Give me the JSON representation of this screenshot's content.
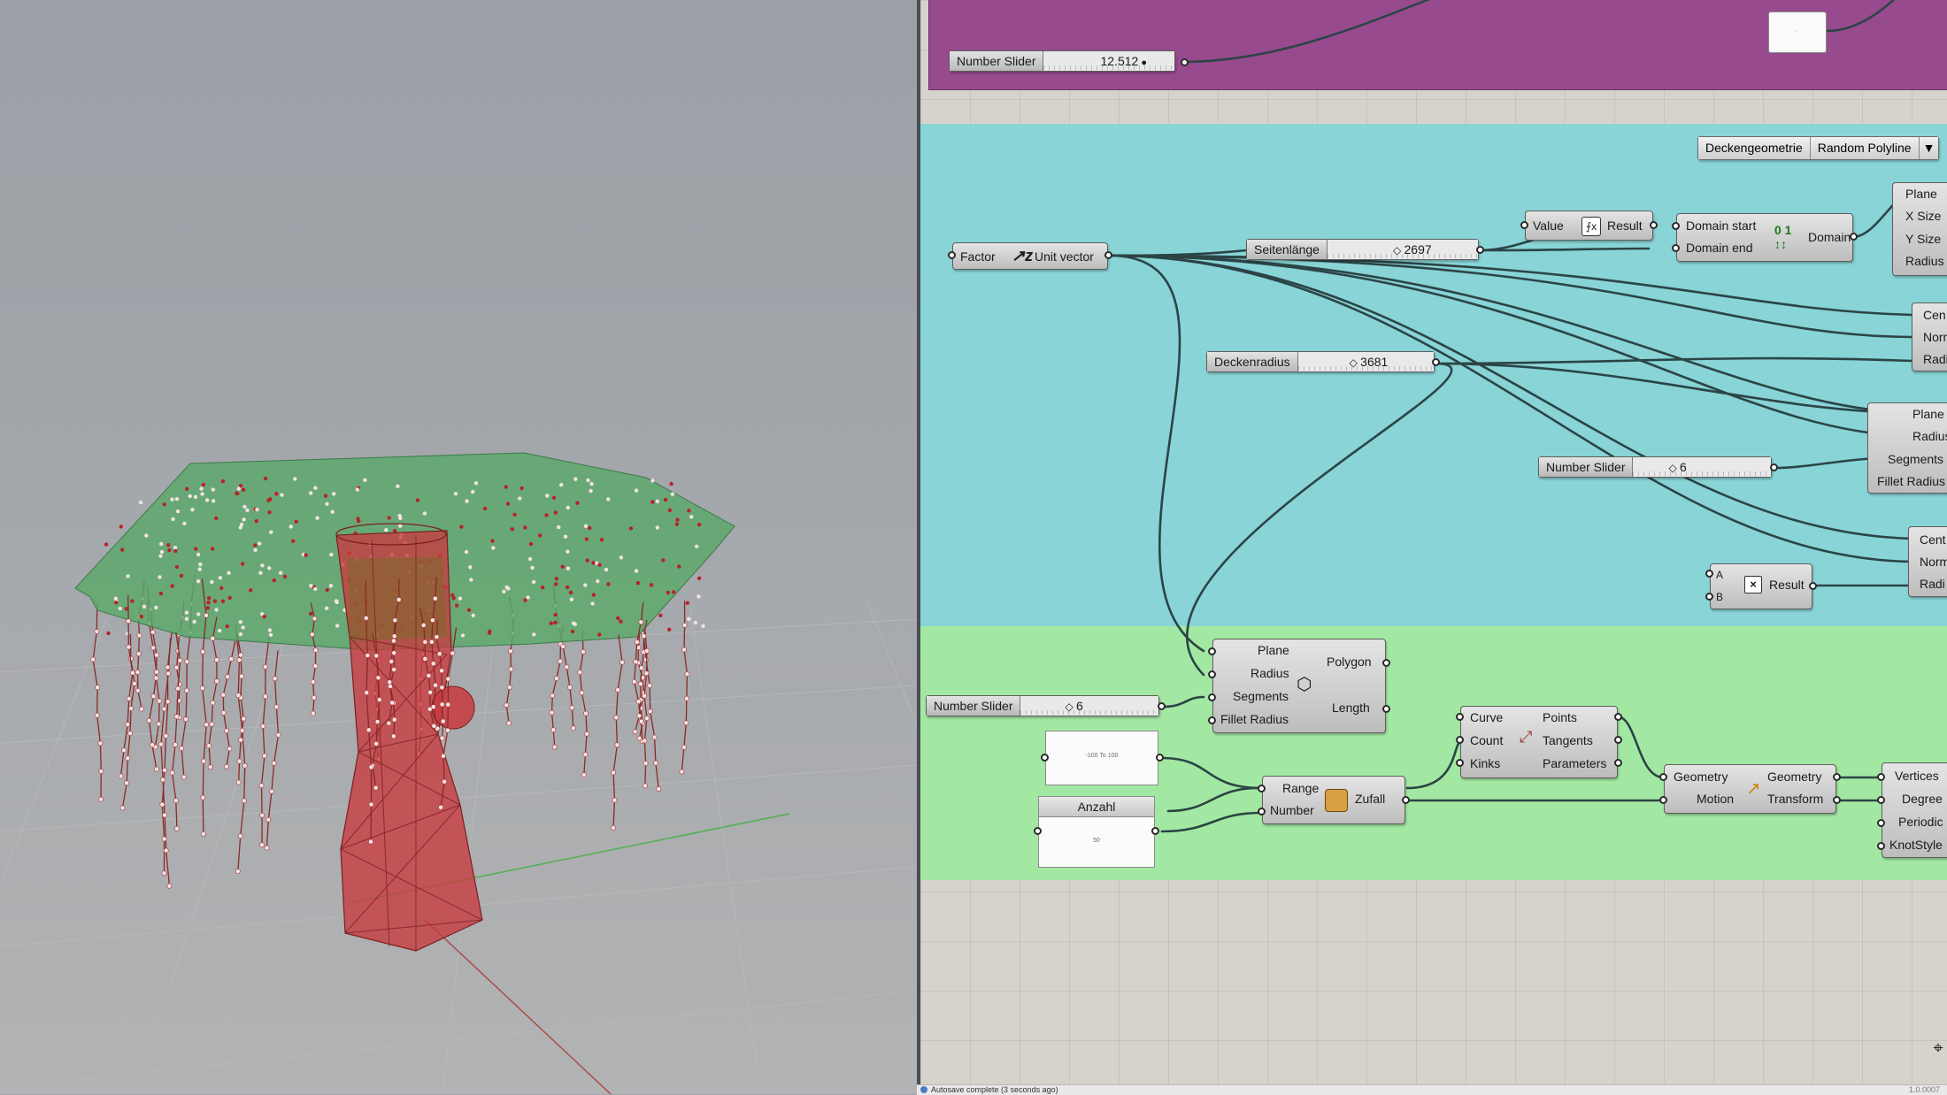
{
  "status": {
    "text": "Autosave complete (3 seconds ago)",
    "version": "1.0.0007"
  },
  "sliders": {
    "top": {
      "name": "Number Slider",
      "value": "12.512"
    },
    "seitenlaenge": {
      "name": "Seitenlänge",
      "value": "2697"
    },
    "deckenradius": {
      "name": "Deckenradius",
      "value": "3681"
    },
    "mid": {
      "name": "Number Slider",
      "value": "6"
    },
    "bottom": {
      "name": "Number Slider",
      "value": "6"
    }
  },
  "valuelist": {
    "name": "Deckengeometrie",
    "value": "Random Polyline"
  },
  "unitvector": {
    "in": "Factor",
    "out": "Unit vector"
  },
  "expression": {
    "in": "Value",
    "out": "Result"
  },
  "domain": {
    "in1": "Domain start",
    "in2": "Domain end",
    "out": "Domain"
  },
  "rect": {
    "inputs": [
      "Plane",
      "X Size",
      "Y Size",
      "Radius"
    ]
  },
  "circle1": {
    "inputs": [
      "Cen",
      "Norm",
      "Radi"
    ]
  },
  "polygon_right": {
    "inputs": [
      "Plane",
      "Radius",
      "Segments",
      "Fillet Radius"
    ]
  },
  "circle2": {
    "inputs": [
      "Cent",
      "Norm",
      "Radi"
    ]
  },
  "multiply": {
    "a": "A",
    "b": "B",
    "out": "Result"
  },
  "polygon": {
    "inputs": [
      "Plane",
      "Radius",
      "Segments",
      "Fillet Radius"
    ],
    "outputs": [
      "Polygon",
      "Length"
    ]
  },
  "divide": {
    "inputs": [
      "Curve",
      "Count",
      "Kinks"
    ],
    "outputs": [
      "Points",
      "Tangents",
      "Parameters"
    ]
  },
  "random": {
    "inputs": [
      "Range",
      "Number"
    ],
    "out": "Zufall"
  },
  "move": {
    "inputs": [
      "Geometry",
      "Motion"
    ],
    "outputs": [
      "Geometry",
      "Transform"
    ]
  },
  "nurbs": {
    "inputs": [
      "Vertices",
      "Degree",
      "Periodic",
      "KnotStyle"
    ]
  },
  "panel_range": {
    "text": "-100 To 100"
  },
  "anzahl": {
    "title": "Anzahl",
    "text": "50"
  },
  "colors": {
    "purple_group": "#984a8f",
    "cyan_group": "#88d4d6",
    "green_group": "#a2e8a2",
    "roof": "#5aa86a",
    "column": "#c83a3e"
  }
}
